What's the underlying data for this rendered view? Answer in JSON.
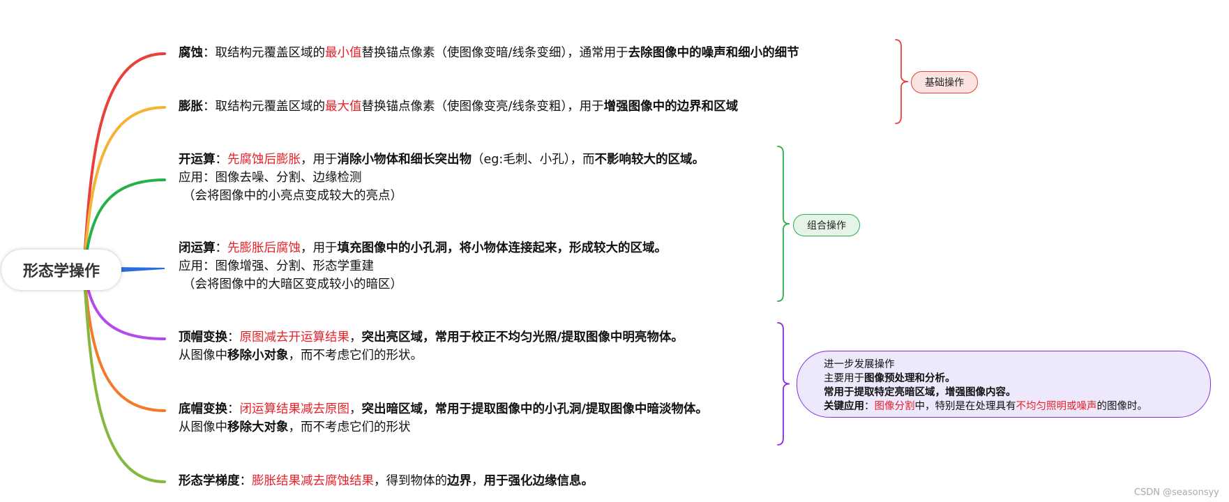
{
  "root": {
    "label": "形态学操作"
  },
  "items": [
    {
      "id": "erosion",
      "color": "#e8413a",
      "lines": [
        [
          {
            "t": "腐蚀",
            "s": "b"
          },
          {
            "t": "：取结构元覆盖区域的"
          },
          {
            "t": "最小值",
            "s": "r"
          },
          {
            "t": "替换锚点像素（使图像变暗/线条变细），通常用于"
          },
          {
            "t": "去除图像中的噪声和细小的细节",
            "s": "b"
          }
        ]
      ]
    },
    {
      "id": "dilation",
      "color": "#f5b335",
      "lines": [
        [
          {
            "t": "膨胀",
            "s": "b"
          },
          {
            "t": "：取结构元覆盖区域的"
          },
          {
            "t": "最大值",
            "s": "r"
          },
          {
            "t": "替换锚点像素（使图像变亮/线条变粗），用于"
          },
          {
            "t": "增强图像中的边界和区域",
            "s": "b"
          }
        ]
      ]
    },
    {
      "id": "opening",
      "color": "#27b04a",
      "lines": [
        [
          {
            "t": "开运算",
            "s": "b"
          },
          {
            "t": "："
          },
          {
            "t": "先腐蚀后膨胀",
            "s": "r"
          },
          {
            "t": "，用于"
          },
          {
            "t": "消除小物体和细长突出物",
            "s": "b"
          },
          {
            "t": "（eg:毛刺、小孔），而"
          },
          {
            "t": "不影响较大的区域。",
            "s": "b"
          }
        ],
        [
          {
            "t": "应用：图像去噪、分割、边缘检测"
          }
        ],
        [
          {
            "t": "（会将图像中的小亮点变成较大的亮点）"
          }
        ]
      ]
    },
    {
      "id": "closing",
      "color": "#2b6de0",
      "lines": [
        [
          {
            "t": "闭运算",
            "s": "b"
          },
          {
            "t": "："
          },
          {
            "t": "先膨胀后腐蚀",
            "s": "r"
          },
          {
            "t": "，用于"
          },
          {
            "t": "填充图像中的小孔洞，将小物体连接起来，形成较大的区域。",
            "s": "b"
          }
        ],
        [
          {
            "t": "应用：图像增强、分割、形态学重建"
          }
        ],
        [
          {
            "t": "（会将图像中的大暗区变成较小的暗区）"
          }
        ]
      ]
    },
    {
      "id": "tophat",
      "color": "#b24be8",
      "lines": [
        [
          {
            "t": "顶帽变换",
            "s": "b"
          },
          {
            "t": "："
          },
          {
            "t": "原图减去开运算结果",
            "s": "r"
          },
          {
            "t": "，"
          },
          {
            "t": "突出亮区域，常用于校正不均匀光照/提取图像中明亮物体。",
            "s": "b"
          }
        ],
        [
          {
            "t": "从图像中"
          },
          {
            "t": "移除小对象",
            "s": "b"
          },
          {
            "t": "，而不考虑它们的形状。"
          }
        ]
      ]
    },
    {
      "id": "blackhat",
      "color": "#f37a2a",
      "lines": [
        [
          {
            "t": "底帽变换",
            "s": "b"
          },
          {
            "t": "："
          },
          {
            "t": "闭运算结果减去原图",
            "s": "r"
          },
          {
            "t": "，"
          },
          {
            "t": "突出暗区域，常用于提取图像中的小孔洞/提取图像中暗淡物体。",
            "s": "b"
          }
        ],
        [
          {
            "t": "从图像中"
          },
          {
            "t": "移除大对象",
            "s": "b"
          },
          {
            "t": "，而不考虑它们的形状"
          }
        ]
      ]
    },
    {
      "id": "gradient",
      "color": "#86b840",
      "lines": [
        [
          {
            "t": "形态学梯度",
            "s": "b"
          },
          {
            "t": "："
          },
          {
            "t": "膨胀结果减去腐蚀结果",
            "s": "r"
          },
          {
            "t": "，得到物体的"
          },
          {
            "t": "边界",
            "s": "b"
          },
          {
            "t": "，"
          },
          {
            "t": "用于强化边缘信息。",
            "s": "b"
          }
        ]
      ]
    }
  ],
  "groups": [
    {
      "id": "basic",
      "label": "基础操作",
      "color": "#e8413a",
      "fill": "#fbe3e2"
    },
    {
      "id": "combined",
      "label": "组合操作",
      "color": "#27b04a",
      "fill": "#e6f4e7"
    }
  ],
  "note": {
    "color": "#8a2be2",
    "lines": [
      [
        {
          "t": "进一步发展操作"
        }
      ],
      [
        {
          "t": "主要用于"
        },
        {
          "t": "图像预处理和分析。",
          "s": "b"
        }
      ],
      [
        {
          "t": "常用于提取特定亮暗区域，增强图像内容。",
          "s": "b"
        }
      ],
      [
        {
          "t": "关键应用",
          "s": "b"
        },
        {
          "t": "："
        },
        {
          "t": "图像分割",
          "s": "r"
        },
        {
          "t": "中，特别是在处理具有"
        },
        {
          "t": "不均匀照明或噪声",
          "s": "r"
        },
        {
          "t": "的图像时。"
        }
      ]
    ]
  },
  "watermark": "CSDN @seasonsyy"
}
